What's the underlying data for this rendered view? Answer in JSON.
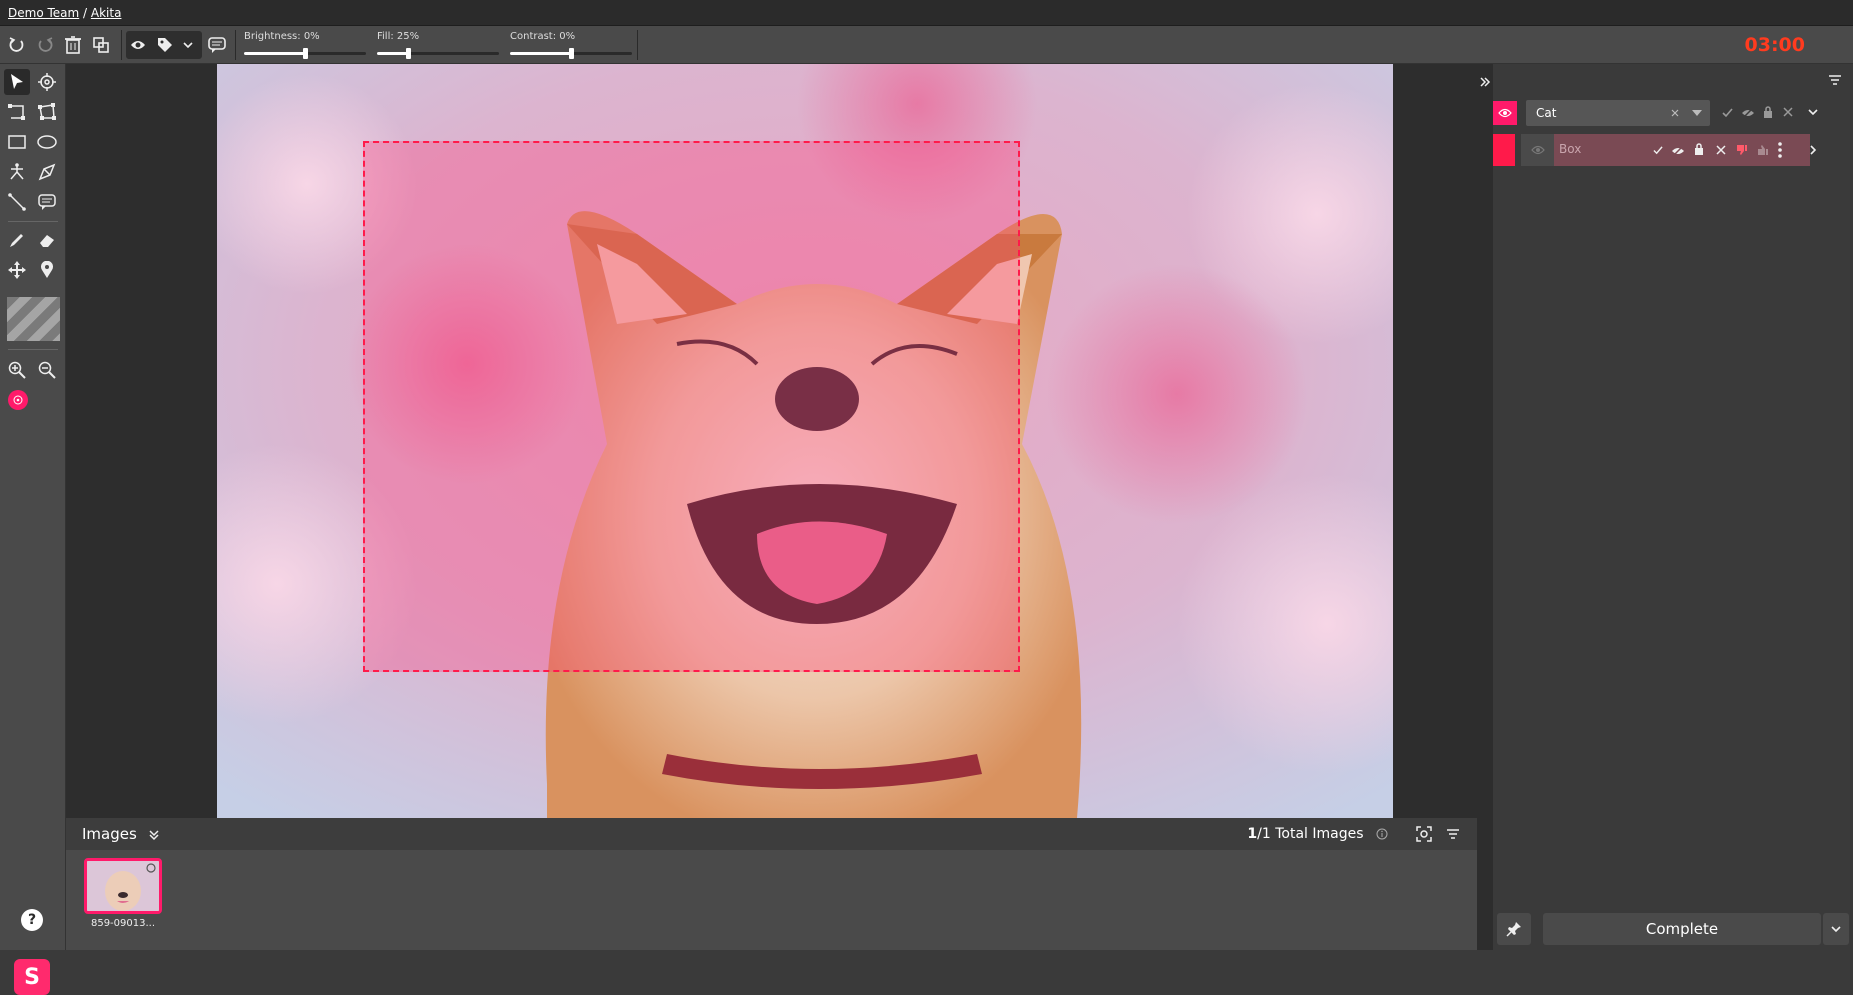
{
  "breadcrumb": {
    "team": "Demo Team",
    "separator": "/",
    "project": "Akita"
  },
  "toolbar": {
    "brightness_label": "Brightness: 0%",
    "brightness_value": 0.5,
    "fill_label": "Fill: 25%",
    "fill_value": 0.25,
    "contrast_label": "Contrast: 0%",
    "contrast_value": 0.5,
    "timer": "03:00"
  },
  "images_panel": {
    "title": "Images",
    "total_count": "1",
    "total_suffix": "/1 Total Images",
    "thumb_caption": "859-09013..."
  },
  "right_panel": {
    "class_name": "Cat",
    "annotation_label": "Box",
    "complete_label": "Complete"
  },
  "help_label": "?",
  "brand_label": "S",
  "colors": {
    "accent": "#ff1a6a",
    "timer": "#ff3b1f",
    "bbox": "#ff1a4a"
  }
}
